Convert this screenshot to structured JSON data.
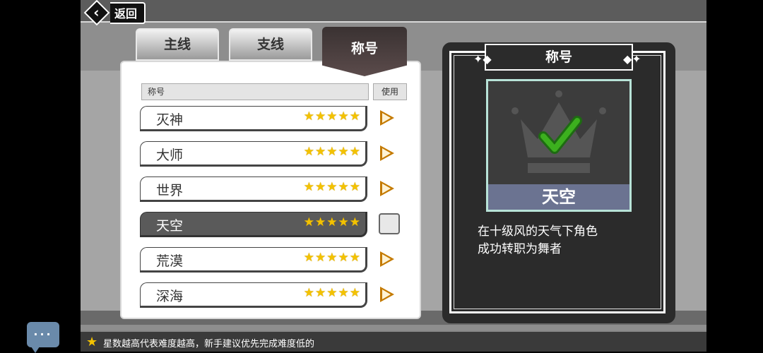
{
  "header": {
    "back_label": "返回"
  },
  "tabs": [
    {
      "label": "主线",
      "active": false
    },
    {
      "label": "支线",
      "active": false
    },
    {
      "label": "称号",
      "active": true
    }
  ],
  "list": {
    "col_title": "称号",
    "col_use": "使用",
    "rows": [
      {
        "label": "灭神",
        "stars": "★★★★★",
        "selected": false
      },
      {
        "label": "大师",
        "stars": "★★★★★",
        "selected": false
      },
      {
        "label": "世界",
        "stars": "★★★★★",
        "selected": false
      },
      {
        "label": "天空",
        "stars": "★★★★★",
        "selected": true
      },
      {
        "label": "荒漠",
        "stars": "★★★★★",
        "selected": false
      },
      {
        "label": "深海",
        "stars": "★★★★★",
        "selected": false
      }
    ]
  },
  "detail": {
    "title": "称号",
    "badge_name": "天空",
    "desc_line1": "在十级风的天气下角色",
    "desc_line2": "成功转职为舞者"
  },
  "footer": {
    "hint": "星数越高代表难度越高，新手建议优先完成难度低的"
  },
  "colors": {
    "star": "#f3c200",
    "badge_frame": "#b8e3d8",
    "check": "#3cb01e"
  }
}
